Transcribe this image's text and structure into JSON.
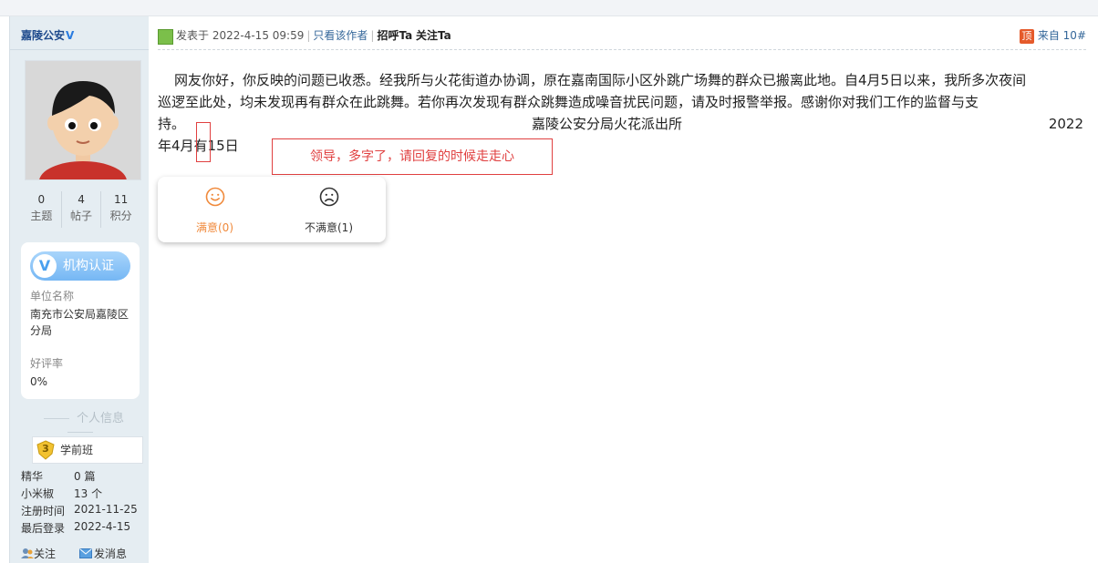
{
  "author": {
    "name": "嘉陵公安",
    "verified_mark": "V"
  },
  "stats": [
    {
      "value": "0",
      "label": "主题"
    },
    {
      "value": "4",
      "label": "帖子"
    },
    {
      "value": "11",
      "label": "积分"
    }
  ],
  "certification": {
    "badge_icon": "V",
    "badge_label": "机构认证",
    "unit_label": "单位名称",
    "unit_value": "南充市公安局嘉陵区分局",
    "rating_label": "好评率",
    "rating_value": "0%"
  },
  "personal_info": {
    "title": "个人信息",
    "level_num": "3",
    "level_label": "学前班",
    "rows": [
      {
        "key": "精华",
        "value": "0 篇"
      },
      {
        "key": "小米椒",
        "value": "13 个"
      },
      {
        "key": "注册时间",
        "value": "2021-11-25"
      },
      {
        "key": "最后登录",
        "value": "2022-4-15"
      }
    ],
    "follow_label": "关注",
    "message_label": "发消息"
  },
  "post": {
    "posted_prefix": "发表于",
    "posted_time": "2022-4-15 09:59",
    "only_author": "只看该作者",
    "greet": "招呼Ta",
    "follow": "关注Ta",
    "top_icon": "顶",
    "floor": "来自 10#",
    "body_line1": "网友你好，你反映的问题已收悉。经我所与火花街道办协调，原在嘉南国际小区外跳广场舞的群众已搬离此地。自4月5日以来，我所多次夜间",
    "body_line2": "巡逻至此处，均未发现再有群众在此跳舞。若你再次发现有群众跳舞造成噪音扰民问题，请及时报警举报。感谢你对我们工作的监督与支",
    "body_line3_start": "持。",
    "signature": "嘉陵公安分局火花派出所",
    "year": "2022",
    "date_line": "年4月有15日",
    "annotation": "领导，多字了，请回复的时候走走心"
  },
  "vote": {
    "satisfied_label": "满意(0)",
    "unsatisfied_label": "不满意(1)",
    "satisfied_color": "#f08a3c",
    "unsatisfied_color": "#333333"
  },
  "colors": {
    "sidebar_bg": "#e5edf2",
    "link": "#336699",
    "annotation_red": "#e04040"
  }
}
